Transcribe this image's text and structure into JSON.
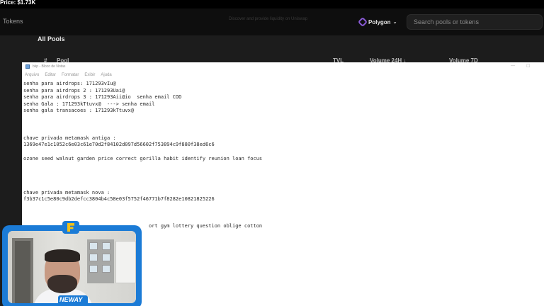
{
  "ticker": {
    "price_text": "Price: $1.73K"
  },
  "header": {
    "tokens_label": "Tokens",
    "faint_text": "Discover and provide liquidity on Uniswap",
    "network": {
      "icon": "polygon-icon",
      "label": "Polygon",
      "chevron": "chevron-down-icon"
    },
    "search": {
      "placeholder": "Search pools or tokens",
      "value": ""
    }
  },
  "pools": {
    "title": "All Pools",
    "columns": [
      "#",
      "Pool",
      "TVL",
      "Volume 24H ↓",
      "Volume 7D"
    ]
  },
  "notepad": {
    "title": "bkp - Bloco de Notas",
    "menu": [
      "Arquivo",
      "Editar",
      "Formatar",
      "Exibir",
      "Ajuda"
    ],
    "lines": [
      "senha para airdrops: 171293vIu@",
      "senha para airdrops 2 : 171293Uai@",
      "senha para airdrops 3 : 171293Aii@io  senha email COD",
      "senha Gala : 171293kTtuvx@  ---> senha email",
      "senha gala transacoes : 171293kTtuvx@",
      "",
      "",
      "",
      "chave privada metamask antiga :",
      "1369e47e1c1052c6e03c61e70d2f84102d097d56602f753894c9f880f38ed6c6",
      "",
      "ozone seed walnut garden price correct gorilla habit identify reunion loan focus",
      "",
      "",
      "",
      "",
      "chave privada metamask nova :",
      "f3b37c1c5e80c9db2defcc3804b4c58e03f5752f46771b7f8282e10821825226",
      "",
      "",
      "",
      "                                          ort gym lottery question oblige cotton"
    ]
  },
  "webcam": {
    "brand_text": "NEWAY"
  }
}
